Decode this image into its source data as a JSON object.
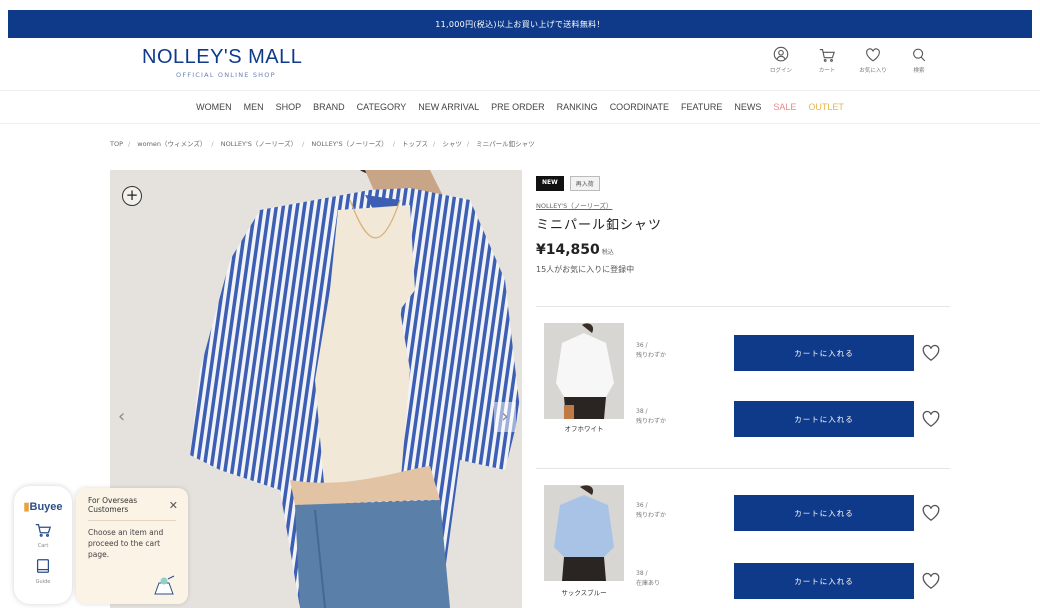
{
  "announcement": "11,000円(税込)以上お買い上げで送料無料！",
  "logo": {
    "main": "NOLLEY'S MALL",
    "sub": "OFFICIAL ONLINE SHOP"
  },
  "header_icons": [
    {
      "name": "login",
      "label": "ログイン",
      "icon": "user-icon"
    },
    {
      "name": "cart",
      "label": "カート",
      "icon": "cart-icon"
    },
    {
      "name": "favorites",
      "label": "お気に入り",
      "icon": "heart-icon"
    },
    {
      "name": "search",
      "label": "検索",
      "icon": "search-icon"
    }
  ],
  "nav": [
    "WOMEN",
    "MEN",
    "SHOP",
    "BRAND",
    "CATEGORY",
    "NEW ARRIVAL",
    "PRE ORDER",
    "RANKING",
    "COORDINATE",
    "FEATURE",
    "NEWS",
    "SALE",
    "OUTLET"
  ],
  "breadcrumb": [
    "TOP",
    "women（ウィメンズ）",
    "NOLLEY'S（ノーリーズ）",
    "NOLLEY'S（ノーリーズ）",
    "トップス",
    "シャツ",
    "ミニパール釦シャツ"
  ],
  "product": {
    "tag_new": "NEW",
    "tag_restock": "再入荷",
    "brand": "NOLLEY'S（ノーリーズ）",
    "name": "ミニパール釦シャツ",
    "price": "¥14,850",
    "tax": "税込",
    "favorite_count": "15人がお気に入りに登録中"
  },
  "variants": [
    {
      "color": "オフホワイト",
      "sizes": [
        {
          "size": "36 /",
          "stock": "残りわずか"
        },
        {
          "size": "38 /",
          "stock": "残りわずか"
        }
      ]
    },
    {
      "color": "サックスブルー",
      "sizes": [
        {
          "size": "36 /",
          "stock": "残りわずか"
        },
        {
          "size": "38 /",
          "stock": "在庫あり"
        }
      ]
    }
  ],
  "cart_button_label": "カートに入れる",
  "buyee": {
    "logo": "Buyee",
    "items": [
      {
        "label": "Cart",
        "icon": "cart-icon"
      },
      {
        "label": "Guide",
        "icon": "book-icon"
      }
    ],
    "popup_title": "For Overseas Customers",
    "popup_body": "Choose an item and proceed to the cart page."
  },
  "colors": {
    "brand_navy": "#0f3a8a",
    "sale": "#e98a8a",
    "outlet": "#e6b64a"
  }
}
